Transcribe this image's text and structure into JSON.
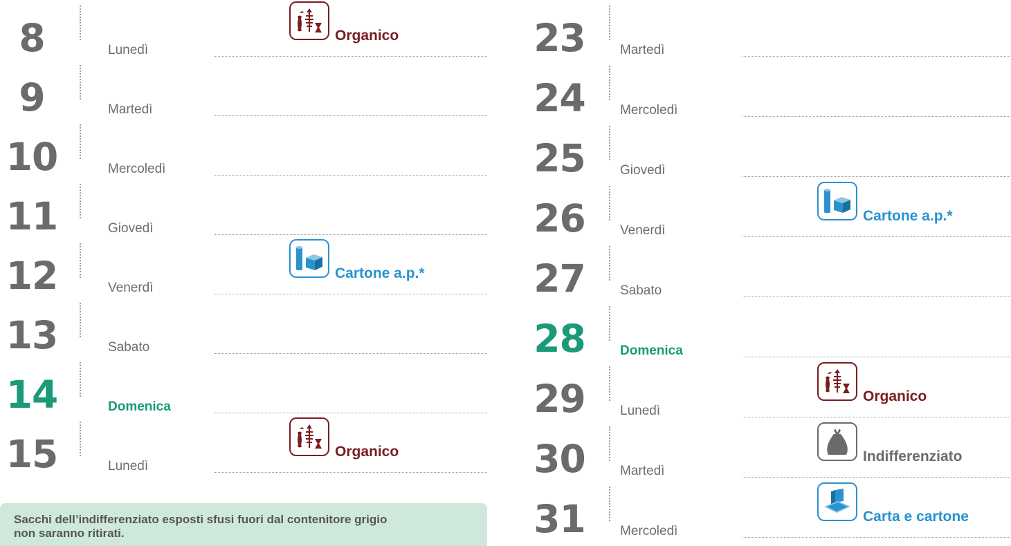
{
  "colors": {
    "number": "#6b6b6b",
    "sunday": "#1a9a78",
    "organico": "#7a1d1f",
    "cartone": "#2a92cf",
    "indifferenziato": "#6b6b6b",
    "notice_bg": "#cfe8dc"
  },
  "left_days": [
    {
      "number": "8",
      "weekday": "Lunedì",
      "sunday": false,
      "collection": {
        "icon": "organic-waste-icon",
        "label": "Organico"
      }
    },
    {
      "number": "9",
      "weekday": "Martedì",
      "sunday": false,
      "collection": null
    },
    {
      "number": "10",
      "weekday": "Mercoledì",
      "sunday": false,
      "collection": null
    },
    {
      "number": "11",
      "weekday": "Giovedì",
      "sunday": false,
      "collection": null
    },
    {
      "number": "12",
      "weekday": "Venerdì",
      "sunday": false,
      "collection": {
        "icon": "packaging-cardboard-icon",
        "label": "Cartone a.p.*"
      }
    },
    {
      "number": "13",
      "weekday": "Sabato",
      "sunday": false,
      "collection": null
    },
    {
      "number": "14",
      "weekday": "Domenica",
      "sunday": true,
      "collection": null
    },
    {
      "number": "15",
      "weekday": "Lunedì",
      "sunday": false,
      "collection": {
        "icon": "organic-waste-icon",
        "label": "Organico"
      }
    }
  ],
  "right_days": [
    {
      "number": "23",
      "weekday": "Martedì",
      "sunday": false,
      "collection": null
    },
    {
      "number": "24",
      "weekday": "Mercoledì",
      "sunday": false,
      "collection": null
    },
    {
      "number": "25",
      "weekday": "Giovedì",
      "sunday": false,
      "collection": null
    },
    {
      "number": "26",
      "weekday": "Venerdì",
      "sunday": false,
      "collection": {
        "icon": "packaging-cardboard-icon",
        "label": "Cartone a.p.*"
      }
    },
    {
      "number": "27",
      "weekday": "Sabato",
      "sunday": false,
      "collection": null
    },
    {
      "number": "28",
      "weekday": "Domenica",
      "sunday": true,
      "collection": null
    },
    {
      "number": "29",
      "weekday": "Lunedì",
      "sunday": false,
      "collection": {
        "icon": "organic-waste-icon",
        "label": "Organico"
      }
    },
    {
      "number": "30",
      "weekday": "Martedì",
      "sunday": false,
      "collection": {
        "icon": "trash-bag-icon",
        "label": "Indifferenziato"
      }
    },
    {
      "number": "31",
      "weekday": "Mercoledì",
      "sunday": false,
      "collection": {
        "icon": "paper-cardboard-icon",
        "label": "Carta e cartone"
      }
    }
  ],
  "notice": {
    "line1": "Sacchi dell’indifferenziato esposti sfusi fuori dal contenitore grigio",
    "line2": "non saranno ritirati."
  }
}
